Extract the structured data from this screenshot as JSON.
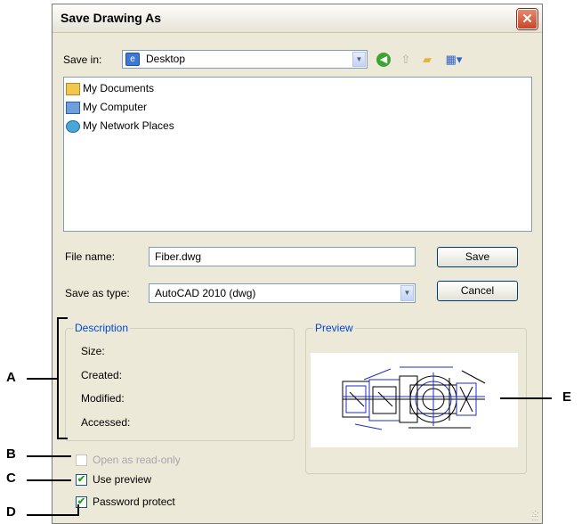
{
  "dialog": {
    "title": "Save Drawing As",
    "close_symbol": "✕"
  },
  "toolbar": {
    "save_in_label": "Save in:",
    "save_in_value": "Desktop",
    "icons": [
      "back-icon",
      "up-folder-icon",
      "new-folder-icon",
      "views-menu-icon"
    ]
  },
  "file_list": {
    "items": [
      {
        "label": "My Documents",
        "icon": "my-documents-icon"
      },
      {
        "label": "My Computer",
        "icon": "my-computer-icon"
      },
      {
        "label": "My Network Places",
        "icon": "network-places-icon"
      }
    ]
  },
  "file_name": {
    "label": "File name:",
    "value": "Fiber.dwg"
  },
  "save_as_type": {
    "label": "Save as type:",
    "value": "AutoCAD 2010 (dwg)"
  },
  "buttons": {
    "save": "Save",
    "cancel": "Cancel"
  },
  "description": {
    "title": "Description",
    "size": "Size:",
    "created": "Created:",
    "modified": "Modified:",
    "accessed": "Accessed:"
  },
  "preview": {
    "title": "Preview"
  },
  "options": {
    "open_read_only": {
      "label": "Open as read-only",
      "checked": false,
      "enabled": false
    },
    "use_preview": {
      "label": "Use preview",
      "checked": true,
      "enabled": true
    },
    "password_protect": {
      "label": "Password protect",
      "checked": true,
      "enabled": true
    }
  },
  "callouts": {
    "a": "A",
    "b": "B",
    "c": "C",
    "d": "D",
    "e": "E"
  },
  "colors": {
    "dialog_bg": "#ece9d8",
    "group_title": "#0046d5",
    "close_red": "#c9452a",
    "check_green": "#21a121"
  }
}
